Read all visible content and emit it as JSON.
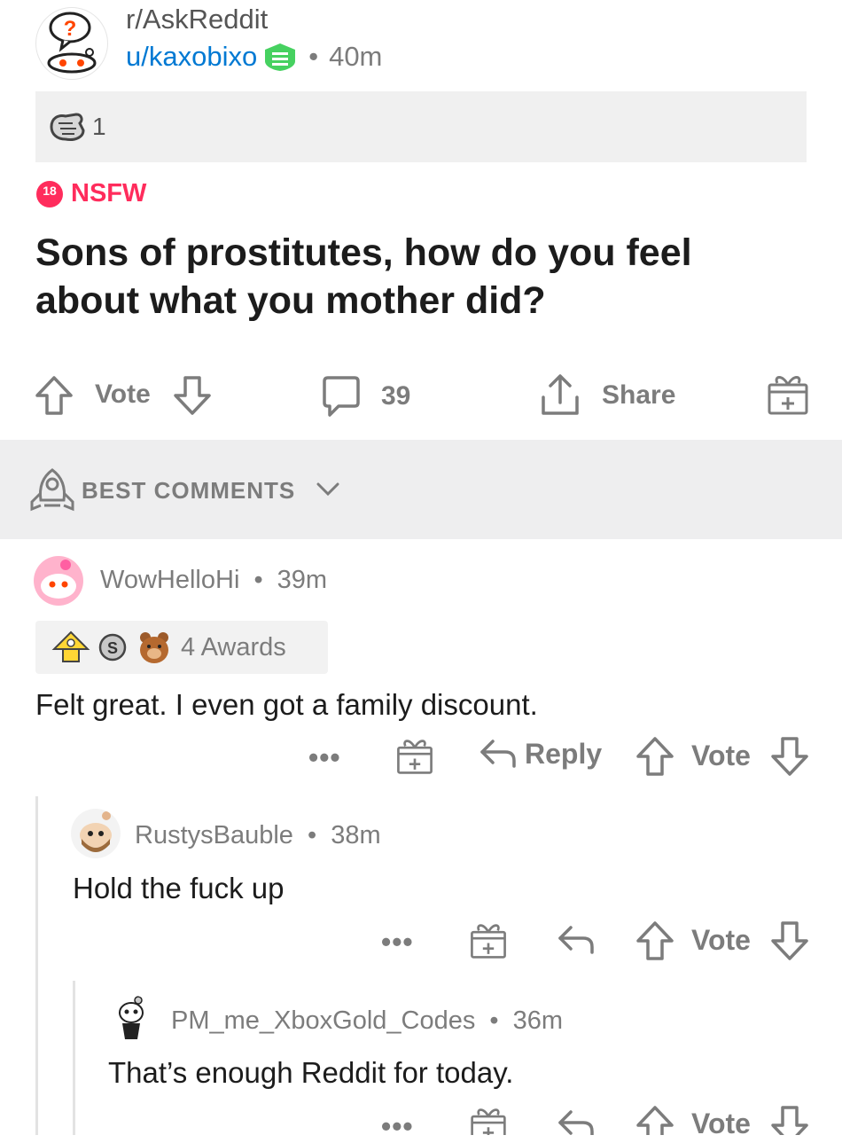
{
  "post": {
    "subreddit": "r/AskReddit",
    "author": "u/kaxobixo",
    "time": "40m",
    "awards_count": "1",
    "nsfw_badge": "18",
    "nsfw_label": "NSFW",
    "title_line1": "Sons of prostitutes, how do you feel",
    "title_line2": "about what you mother did?",
    "vote_label": "Vote",
    "comments_count": "39",
    "share_label": "Share"
  },
  "sort": {
    "label": "BEST COMMENTS"
  },
  "comments": [
    {
      "author": "WowHelloHi",
      "time": "39m",
      "awards_label": "4 Awards",
      "body": "Felt great. I even got a family discount.",
      "reply_label": "Reply",
      "vote_label": "Vote"
    },
    {
      "author": "RustysBauble",
      "time": "38m",
      "body": "Hold the fuck up",
      "vote_label": "Vote"
    },
    {
      "author": "PM_me_XboxGold_Codes",
      "time": "36m",
      "body": "That’s enough Reddit for today.",
      "vote_label": "Vote"
    }
  ],
  "colors": {
    "nsfw": "#ff2c5c",
    "moderator_icon": "#46d160",
    "meta_text": "#7c7c7c",
    "awards_bg": "#f2f2f2",
    "sort_bg": "#eeeeef"
  }
}
